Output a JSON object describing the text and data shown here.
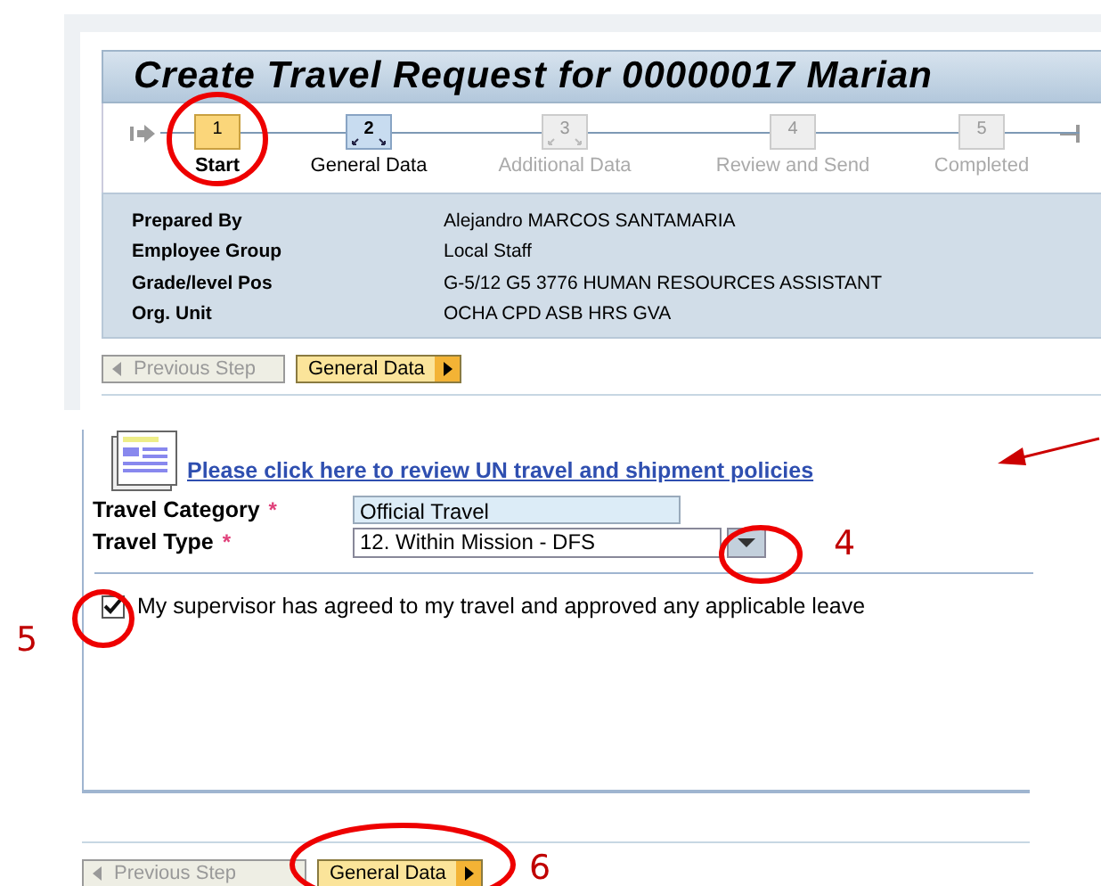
{
  "title": "Create Travel Request for 00000017 Marian",
  "steps": [
    {
      "number": "1",
      "label": "Start",
      "selected": true,
      "disabled": false,
      "kind": "plain"
    },
    {
      "number": "2",
      "label": "General Data",
      "selected": false,
      "disabled": false,
      "kind": "linked"
    },
    {
      "number": "3",
      "label": "Additional Data",
      "selected": false,
      "disabled": true,
      "kind": "linked"
    },
    {
      "number": "4",
      "label": "Review and Send",
      "selected": false,
      "disabled": true,
      "kind": "plain"
    },
    {
      "number": "5",
      "label": "Completed",
      "selected": false,
      "disabled": true,
      "kind": "plain"
    }
  ],
  "info": [
    {
      "label": "Prepared By",
      "value": "Alejandro MARCOS SANTAMARIA"
    },
    {
      "label": "Employee Group",
      "value": "Local Staff"
    },
    {
      "label": "Grade/level Pos",
      "value": "G-5/12 G5 3776 HUMAN RESOURCES ASSISTANT"
    },
    {
      "label": "Org. Unit",
      "value": "OCHA CPD ASB HRS GVA"
    }
  ],
  "nav_top": {
    "previous": "Previous Step",
    "next": "General Data"
  },
  "policy_link": "Please click here to review UN travel and shipment policies",
  "fields": [
    {
      "label": "Travel Category",
      "required_mark": "*",
      "value": "Official Travel",
      "kind": "text"
    },
    {
      "label": "Travel Type",
      "required_mark": "*",
      "value": "12. Within Mission - DFS",
      "kind": "dropdown"
    }
  ],
  "agreement": {
    "label": "My supervisor has agreed to my travel and approved any applicable leave",
    "checked": true
  },
  "nav_bottom": {
    "previous": "Previous Step",
    "next": "General Data"
  },
  "annotations": [
    "4",
    "5",
    "6"
  ]
}
